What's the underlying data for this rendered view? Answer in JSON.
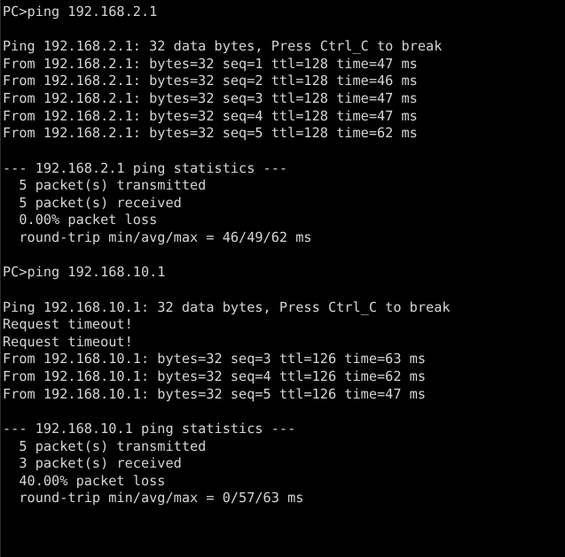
{
  "terminal": {
    "app": "packet-tracer-command-prompt",
    "background_color": "#000000",
    "text_color": "#d6d6d6",
    "prompt": "PC>",
    "lines": [
      "PC>ping 192.168.2.1",
      "",
      "Ping 192.168.2.1: 32 data bytes, Press Ctrl_C to break",
      "From 192.168.2.1: bytes=32 seq=1 ttl=128 time=47 ms",
      "From 192.168.2.1: bytes=32 seq=2 ttl=128 time=46 ms",
      "From 192.168.2.1: bytes=32 seq=3 ttl=128 time=47 ms",
      "From 192.168.2.1: bytes=32 seq=4 ttl=128 time=47 ms",
      "From 192.168.2.1: bytes=32 seq=5 ttl=128 time=62 ms",
      "",
      "--- 192.168.2.1 ping statistics ---",
      "  5 packet(s) transmitted",
      "  5 packet(s) received",
      "  0.00% packet loss",
      "  round-trip min/avg/max = 46/49/62 ms",
      "",
      "PC>ping 192.168.10.1",
      "",
      "Ping 192.168.10.1: 32 data bytes, Press Ctrl_C to break",
      "Request timeout!",
      "Request timeout!",
      "From 192.168.10.1: bytes=32 seq=3 ttl=126 time=63 ms",
      "From 192.168.10.1: bytes=32 seq=4 ttl=126 time=62 ms",
      "From 192.168.10.1: bytes=32 seq=5 ttl=126 time=47 ms",
      "",
      "--- 192.168.10.1 ping statistics ---",
      "  5 packet(s) transmitted",
      "  3 packet(s) received",
      "  40.00% packet loss",
      "  round-trip min/avg/max = 0/57/63 ms"
    ],
    "sessions": [
      {
        "command": "ping 192.168.2.1",
        "target": "192.168.2.1",
        "header": "Ping 192.168.2.1: 32 data bytes, Press Ctrl_C to break",
        "data_bytes": 32,
        "break_key": "Ctrl_C",
        "replies": [
          {
            "from": "192.168.2.1",
            "bytes": 32,
            "seq": 1,
            "ttl": 128,
            "time_ms": 47
          },
          {
            "from": "192.168.2.1",
            "bytes": 32,
            "seq": 2,
            "ttl": 128,
            "time_ms": 46
          },
          {
            "from": "192.168.2.1",
            "bytes": 32,
            "seq": 3,
            "ttl": 128,
            "time_ms": 47
          },
          {
            "from": "192.168.2.1",
            "bytes": 32,
            "seq": 4,
            "ttl": 128,
            "time_ms": 47
          },
          {
            "from": "192.168.2.1",
            "bytes": 32,
            "seq": 5,
            "ttl": 128,
            "time_ms": 62
          }
        ],
        "timeouts": 0,
        "statistics": {
          "header": "--- 192.168.2.1 ping statistics ---",
          "transmitted": "  5 packet(s) transmitted",
          "received": "  5 packet(s) received",
          "loss": "  0.00% packet loss",
          "round_trip": "  round-trip min/avg/max = 46/49/62 ms",
          "min_ms": 46,
          "avg_ms": 49,
          "max_ms": 62,
          "loss_percent": "0.00%"
        }
      },
      {
        "command": "ping 192.168.10.1",
        "target": "192.168.10.1",
        "header": "Ping 192.168.10.1: 32 data bytes, Press Ctrl_C to break",
        "data_bytes": 32,
        "break_key": "Ctrl_C",
        "timeout_text": "Request timeout!",
        "timeouts": 2,
        "replies": [
          {
            "from": "192.168.10.1",
            "bytes": 32,
            "seq": 3,
            "ttl": 126,
            "time_ms": 63
          },
          {
            "from": "192.168.10.1",
            "bytes": 32,
            "seq": 4,
            "ttl": 126,
            "time_ms": 62
          },
          {
            "from": "192.168.10.1",
            "bytes": 32,
            "seq": 5,
            "ttl": 126,
            "time_ms": 47
          }
        ],
        "statistics": {
          "header": "--- 192.168.10.1 ping statistics ---",
          "transmitted": "  5 packet(s) transmitted",
          "received": "  3 packet(s) received",
          "loss": "  40.00% packet loss",
          "round_trip": "  round-trip min/avg/max = 0/57/63 ms",
          "min_ms": 0,
          "avg_ms": 57,
          "max_ms": 63,
          "loss_percent": "40.00%"
        }
      }
    ]
  }
}
